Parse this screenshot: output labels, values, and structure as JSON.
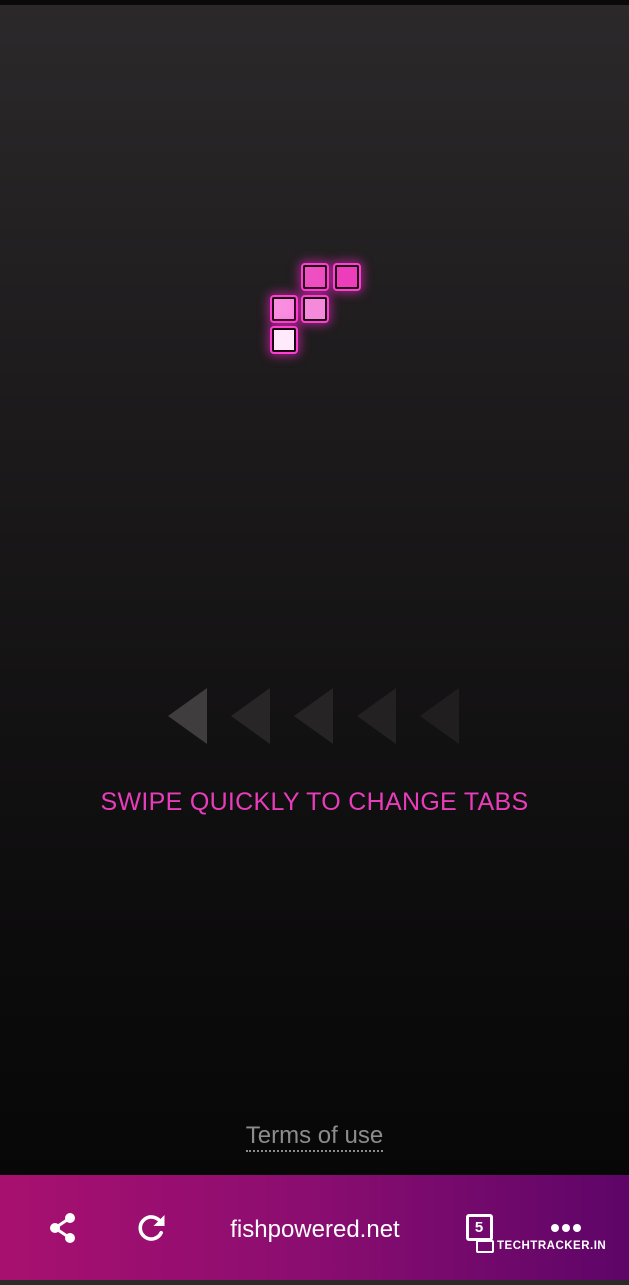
{
  "logo": {
    "icon": "tetromino-logo-icon",
    "accent_color": "#ec3dbb"
  },
  "hint": {
    "icon": "swipe-left-arrows-icon",
    "text": "SWIPE QUICKLY TO CHANGE TABS",
    "color": "#e93cba"
  },
  "footer": {
    "terms_label": "Terms of use"
  },
  "toolbar": {
    "share_icon": "share-icon",
    "reload_icon": "reload-icon",
    "url": "fishpowered.net",
    "tab_count": "5",
    "more_icon": "more-dots-icon",
    "gradient": [
      "#a8106f",
      "#5e0568"
    ]
  },
  "watermark": {
    "text": "TechTracker.in"
  }
}
